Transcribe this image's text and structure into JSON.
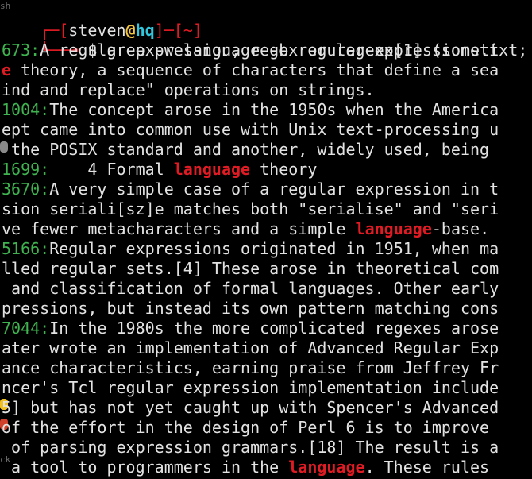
{
  "window": {
    "prompt": {
      "user": "steven",
      "at": "@",
      "host": "hq",
      "dir": "~",
      "dollar": "$",
      "command": "grep -w language -b regular-expressions.txt;"
    },
    "background_labels": [
      "sh",
      "ck"
    ]
  },
  "colors": {
    "background": "#000000",
    "text": "#e2e2e2",
    "offset": "#3fb34f",
    "match": "#e01b24",
    "host": "#33c7de",
    "at": "#f2c744"
  },
  "lines": [
    {
      "offset": "673:",
      "segments": [
        {
          "t": "A regular expression, regex or regexp[1] (someti",
          "m": false
        }
      ]
    },
    {
      "offset": "",
      "segments": [
        {
          "t": "e",
          "m": true
        },
        {
          "t": " theory, a sequence of characters that define a sea",
          "m": false
        }
      ]
    },
    {
      "offset": "",
      "segments": [
        {
          "t": "ind and replace\" operations on strings.",
          "m": false
        }
      ]
    },
    {
      "offset": "1004:",
      "segments": [
        {
          "t": "The concept arose in the 1950s when the America",
          "m": false
        }
      ]
    },
    {
      "offset": "",
      "segments": [
        {
          "t": "ept came into common use with Unix text-processing u",
          "m": false
        }
      ]
    },
    {
      "offset": "",
      "segments": [
        {
          "t": " the POSIX standard and another, widely used, being ",
          "m": false
        }
      ]
    },
    {
      "offset": "1699:",
      "segments": [
        {
          "t": "    4 Formal ",
          "m": false
        },
        {
          "t": "language",
          "m": true
        },
        {
          "t": " theory",
          "m": false
        }
      ]
    },
    {
      "offset": "3670:",
      "segments": [
        {
          "t": "A very simple case of a regular expression in t",
          "m": false
        }
      ]
    },
    {
      "offset": "",
      "segments": [
        {
          "t": "sion seriali[sz]e matches both \"serialise\" and \"seri",
          "m": false
        }
      ]
    },
    {
      "offset": "",
      "segments": [
        {
          "t": "ve fewer metacharacters and a simple ",
          "m": false
        },
        {
          "t": "language",
          "m": true
        },
        {
          "t": "-base.",
          "m": false
        }
      ]
    },
    {
      "offset": "5166:",
      "segments": [
        {
          "t": "Regular expressions originated in 1951, when ma",
          "m": false
        }
      ]
    },
    {
      "offset": "",
      "segments": [
        {
          "t": "lled regular sets.[4] These arose in theoretical com",
          "m": false
        }
      ]
    },
    {
      "offset": "",
      "segments": [
        {
          "t": " and classification of formal languages. Other early",
          "m": false
        }
      ]
    },
    {
      "offset": "",
      "segments": [
        {
          "t": "pressions, but instead its own pattern matching cons",
          "m": false
        }
      ]
    },
    {
      "offset": "7044:",
      "segments": [
        {
          "t": "In the 1980s the more complicated regexes arose",
          "m": false
        }
      ]
    },
    {
      "offset": "",
      "segments": [
        {
          "t": "ater wrote an implementation of Advanced Regular Exp",
          "m": false
        }
      ]
    },
    {
      "offset": "",
      "segments": [
        {
          "t": "ance characteristics, earning praise from Jeffrey Fr",
          "m": false
        }
      ]
    },
    {
      "offset": "",
      "segments": [
        {
          "t": "ncer's Tcl regular expression implementation include",
          "m": false
        }
      ]
    },
    {
      "offset": "",
      "segments": [
        {
          "t": "5] but has not yet caught up with Spencer's Advanced",
          "m": false
        }
      ]
    },
    {
      "offset": "",
      "segments": [
        {
          "t": "of the effort in the design of Perl 6 is to improve ",
          "m": false
        }
      ]
    },
    {
      "offset": "",
      "segments": [
        {
          "t": " of parsing expression grammars.[18] The result is a",
          "m": false
        }
      ]
    },
    {
      "offset": "",
      "segments": [
        {
          "t": " a tool to programmers in the ",
          "m": false
        },
        {
          "t": "language",
          "m": true
        },
        {
          "t": ". These rules",
          "m": false
        }
      ]
    }
  ]
}
